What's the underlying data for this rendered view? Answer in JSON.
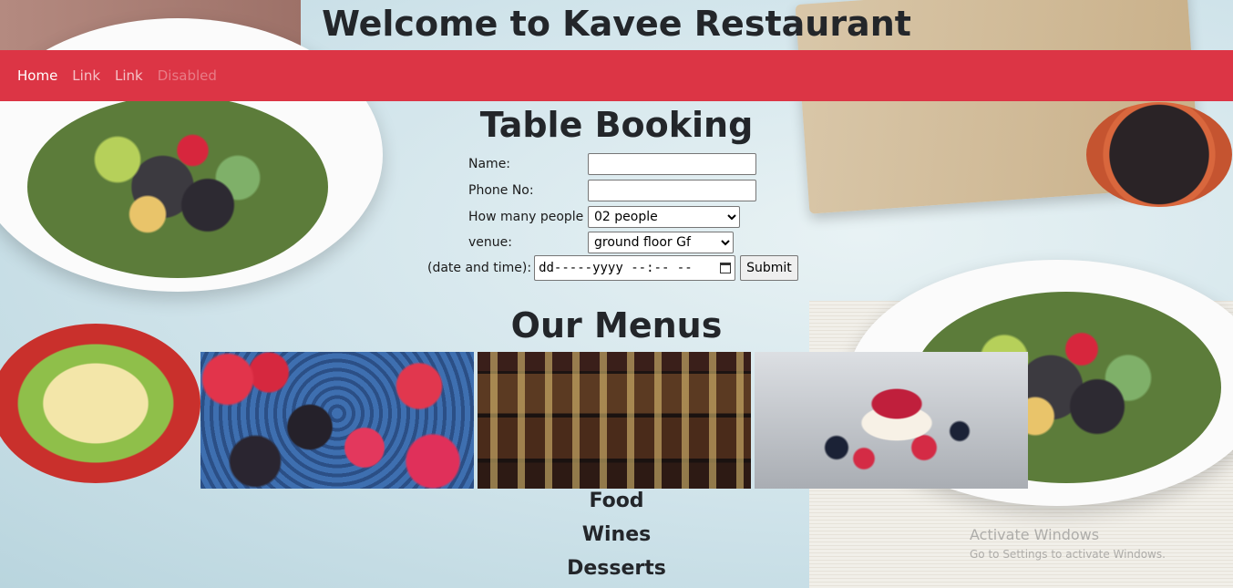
{
  "site": {
    "title": "Welcome to Kavee Restaurant"
  },
  "nav": {
    "items": [
      {
        "label": "Home"
      },
      {
        "label": "Link"
      },
      {
        "label": "Link"
      },
      {
        "label": "Disabled"
      }
    ]
  },
  "booking": {
    "title": "Table Booking",
    "name_label": "Name:",
    "name_value": "",
    "phone_label": "Phone No:",
    "phone_value": "",
    "people_label": "How many people",
    "people_selected": "02 people",
    "venue_label": "venue:",
    "venue_selected": "ground floor Gf",
    "datetime_label": "(date and time):",
    "datetime_placeholder": "dd-----yyyy  --:--  --",
    "submit_label": "Submit"
  },
  "menus": {
    "title": "Our Menus",
    "items": [
      {
        "label": "Food"
      },
      {
        "label": "Wines"
      },
      {
        "label": "Desserts"
      }
    ]
  },
  "watermark": {
    "line1": "Activate Windows",
    "line2": "Go to Settings to activate Windows."
  },
  "colors": {
    "navbar": "#dc3545"
  }
}
